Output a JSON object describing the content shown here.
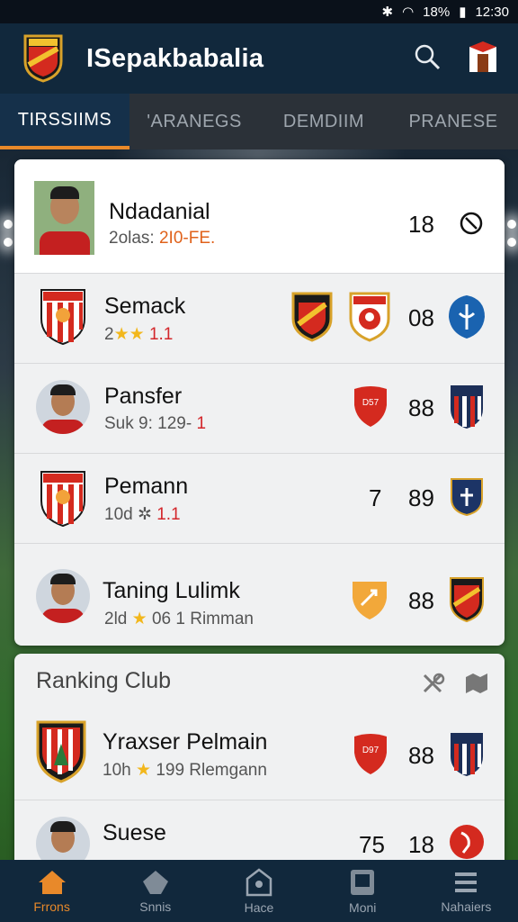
{
  "status": {
    "time": "12:30",
    "battery": "18%"
  },
  "app": {
    "title": "ISepakbabalia"
  },
  "tabs": [
    {
      "label": "TIRSSIIMS",
      "active": true
    },
    {
      "label": "'ARANEGS",
      "active": false
    },
    {
      "label": "DEMDIIM",
      "active": false
    },
    {
      "label": "PRANESE",
      "active": false
    }
  ],
  "players": [
    {
      "name": "Ndadanial",
      "sub_prefix": "2olas: ",
      "sub_hl": "2I0-FE.",
      "value1": "",
      "value2": "18",
      "icon": "clock-icon"
    },
    {
      "name": "Semack",
      "sub_prefix": "2",
      "sub_hl": "1.1",
      "value1": "",
      "value2": "08",
      "icon": "club-badge-icon"
    },
    {
      "name": "Pansfer",
      "sub_prefix": "Suk 9: 129- ",
      "sub_hl": "1",
      "value1": "",
      "value2": "88",
      "icon": "club-badge-icon"
    },
    {
      "name": "Pemann",
      "sub_prefix": "10d ✲ ",
      "sub_hl": "1.1",
      "value1": "7",
      "value2": "89",
      "icon": "club-badge-icon"
    },
    {
      "name": "Taning Lulimk",
      "sub_prefix": "2ld ",
      "sub_hl": "06 1 Rimman",
      "value1": "",
      "value2": "88",
      "icon": "club-badge-icon"
    }
  ],
  "ranking": {
    "title": "Ranking Club",
    "rows": [
      {
        "name": "Yraxser Pelmain",
        "sub_prefix": "10h ",
        "sub_hl": "199 Rlemgann",
        "value2": "88"
      },
      {
        "name": "Suese",
        "sub_prefix": "",
        "sub_hl": "",
        "value1": "75",
        "value2": "18"
      }
    ]
  },
  "bottom_nav": [
    {
      "label": "Frrons",
      "icon": "home-icon",
      "active": true
    },
    {
      "label": "Snnis",
      "icon": "ball-icon",
      "active": false
    },
    {
      "label": "Hace",
      "icon": "stadium-icon",
      "active": false
    },
    {
      "label": "Moni",
      "icon": "tablet-icon",
      "active": false
    },
    {
      "label": "Nahaiers",
      "icon": "list-icon",
      "active": false
    }
  ],
  "colors": {
    "accent": "#e8892a",
    "appbar": "#11283c",
    "tabbar": "#2b3138"
  }
}
